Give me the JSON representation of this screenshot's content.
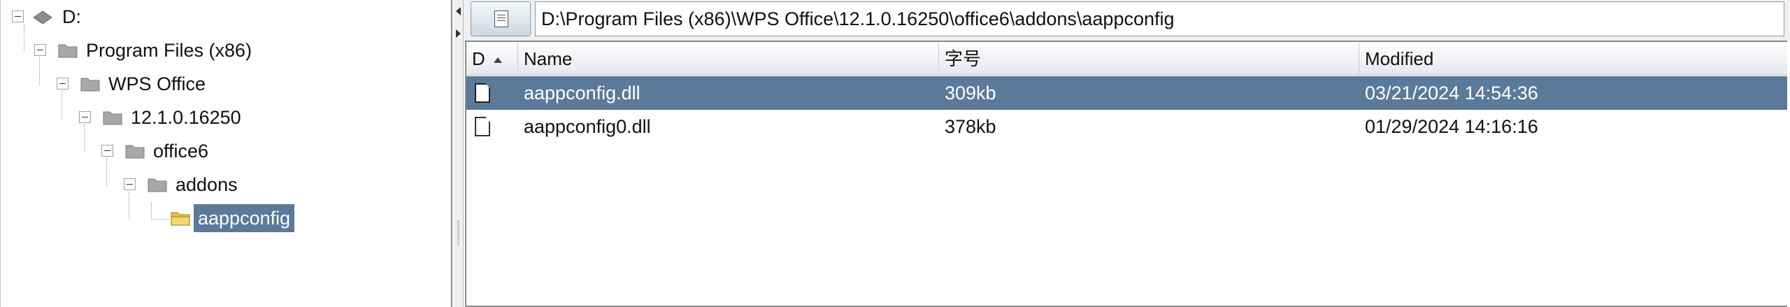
{
  "tree": {
    "nodes": [
      {
        "label": "D:",
        "icon": "drive-icon"
      },
      {
        "label": "Program Files (x86)",
        "icon": "folder-icon"
      },
      {
        "label": "WPS Office",
        "icon": "folder-icon"
      },
      {
        "label": "12.1.0.16250",
        "icon": "folder-icon"
      },
      {
        "label": "office6",
        "icon": "folder-icon"
      },
      {
        "label": "addons",
        "icon": "folder-icon"
      },
      {
        "label": "aappconfig",
        "icon": "folder-open-icon",
        "selected": true
      }
    ]
  },
  "path_bar": {
    "value": "D:\\Program Files (x86)\\WPS Office\\12.1.0.16250\\office6\\addons\\aappconfig"
  },
  "file_list": {
    "columns": [
      "D",
      "Name",
      "字号",
      "Modified"
    ],
    "sort_column": "D",
    "rows": [
      {
        "name": "aappconfig.dll",
        "size": "309kb",
        "modified": "03/21/2024 14:54:36",
        "selected": true
      },
      {
        "name": "aappconfig0.dll",
        "size": "378kb",
        "modified": "01/29/2024 14:16:16",
        "selected": false
      }
    ]
  },
  "colors": {
    "selection": "#5b7a9a",
    "folder": "#a8a8a8",
    "open_folder": "#f0c040"
  }
}
